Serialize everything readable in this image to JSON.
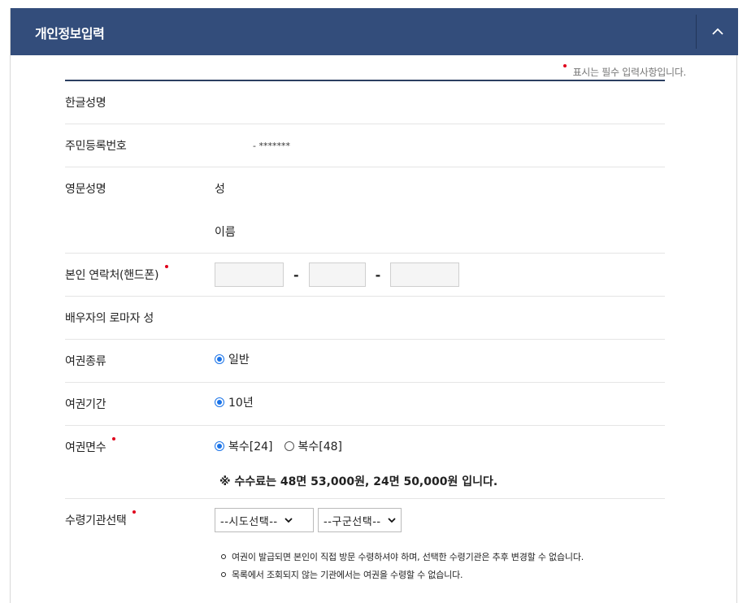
{
  "header": {
    "title": "개인정보입력",
    "collapse_icon": "chevron-up-icon"
  },
  "required_note": "표시는 필수 입력사항입니다.",
  "colors": {
    "header_bg": "#334d7b",
    "required_dot": "#e0001b",
    "radio_selected": "#1a73e8"
  },
  "fields": {
    "korean_name": {
      "label": "한글성명"
    },
    "resident_number": {
      "label": "주민등록번호",
      "value": "- *******"
    },
    "english_name": {
      "label": "영문성명",
      "surname_label": "성",
      "given_name_label": "이름"
    },
    "phone": {
      "label": "본인 연락처(핸드폰)",
      "separator": "-"
    },
    "spouse_roman_surname": {
      "label": "배우자의 로마자 성"
    },
    "passport_type": {
      "label": "여권종류",
      "options": [
        {
          "label": "일반",
          "selected": true
        }
      ]
    },
    "passport_period": {
      "label": "여권기간",
      "options": [
        {
          "label": "10년",
          "selected": true
        }
      ]
    },
    "passport_pages": {
      "label": "여권면수",
      "options": [
        {
          "label": "복수[24]",
          "selected": true
        },
        {
          "label": "복수[48]",
          "selected": false
        }
      ],
      "fee_note": "※ 수수료는 48면 53,000원, 24면 50,000원 입니다."
    },
    "pickup_office": {
      "label": "수령기관선택",
      "province_select": "--시도선택--",
      "district_select": "--구군선택--",
      "notes": [
        "여권이 발급되면 본인이 직접 방문 수령하셔야 하며, 선택한 수령기관은 추후 변경할 수 없습니다.",
        "목록에서 조회되지 않는 기관에서는 여권을 수령할 수 없습니다."
      ]
    }
  }
}
